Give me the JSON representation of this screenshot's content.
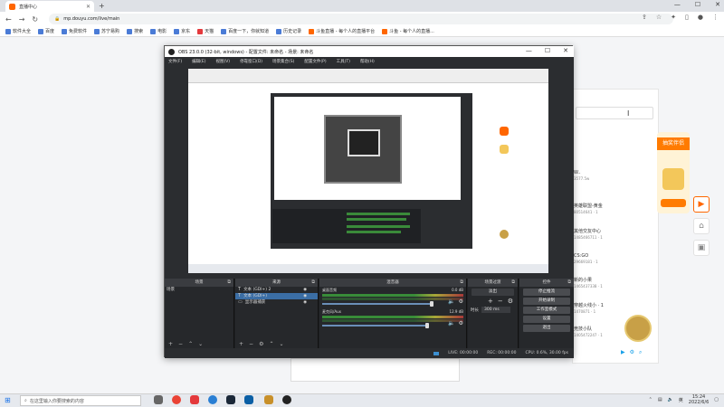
{
  "browser": {
    "tab_title": "直播中心",
    "address": "mp.douyu.com/live/main",
    "bookmarks": [
      "软件大全",
      "百度",
      "免费软件",
      "苏宁易购",
      "搜索",
      "电影",
      "京东",
      "天猫",
      "百度一下，你就知道",
      "历史记录",
      "斗鱼直播 - 每个人的直播平台",
      "斗鱼 - 每个人的直播..."
    ]
  },
  "obs": {
    "title": "OBS 23.0.0 (32-bit, windows) - 配置文件: 未命名 - 场景: 未命名",
    "menu": [
      "文件(F)",
      "编辑(E)",
      "视图(V)",
      "停靠窗口(D)",
      "场景集合(S)",
      "配置文件(P)",
      "工具(T)",
      "帮助(H)"
    ],
    "docks": {
      "scenes": {
        "title": "场景",
        "items": [
          "场景"
        ]
      },
      "sources": {
        "title": "来源",
        "items": [
          {
            "name": "文本 (GDI+) 2",
            "selected": false
          },
          {
            "name": "文本 (GDI+)",
            "selected": true
          },
          {
            "name": "显示器捕获",
            "selected": false
          }
        ]
      },
      "mixer": {
        "title": "混音器",
        "tracks": [
          {
            "name": "桌面音频",
            "db": "0.0 dB",
            "level": 0.86
          },
          {
            "name": "麦克风/Aux",
            "db": "12.9 dB",
            "level": 0.82
          }
        ]
      },
      "transitions": {
        "title": "场景过渡",
        "mode": "淡出",
        "duration_label": "时长",
        "duration": "300 ms"
      },
      "controls": {
        "title": "控件",
        "buttons": [
          "停止推流",
          "开始录制",
          "工作室模式",
          "设置",
          "退出"
        ]
      }
    },
    "status": {
      "live": "LIVE: 00:00:00",
      "rec": "REC: 00:00:00",
      "cpu": "CPU: 0.6%, 30.00 fps"
    }
  },
  "right_panel": {
    "search_caret": "I",
    "ad_text": "抽奖伴侣",
    "items": [
      {
        "name": "W..",
        "sub": "3577.5w"
      },
      {
        "name": "英雄联盟-黄金",
        "sub": "80514641 · 1"
      },
      {
        "name": "其他交友中心",
        "sub": "1485466711 · 1"
      },
      {
        "name": "CS:GO",
        "sub": "29669181 · 1"
      },
      {
        "name": "新的小果",
        "sub": "1465437338 · 1"
      },
      {
        "name": "穿越火线小 · 1",
        "sub": "1470871 · 1"
      },
      {
        "name": "竞技小队",
        "sub": "1405472247 · 1"
      }
    ]
  },
  "taskbar": {
    "search_placeholder": "在这里输入你要搜索的内容",
    "lang": "英",
    "time": "15:24",
    "date": "2022/6/6"
  }
}
